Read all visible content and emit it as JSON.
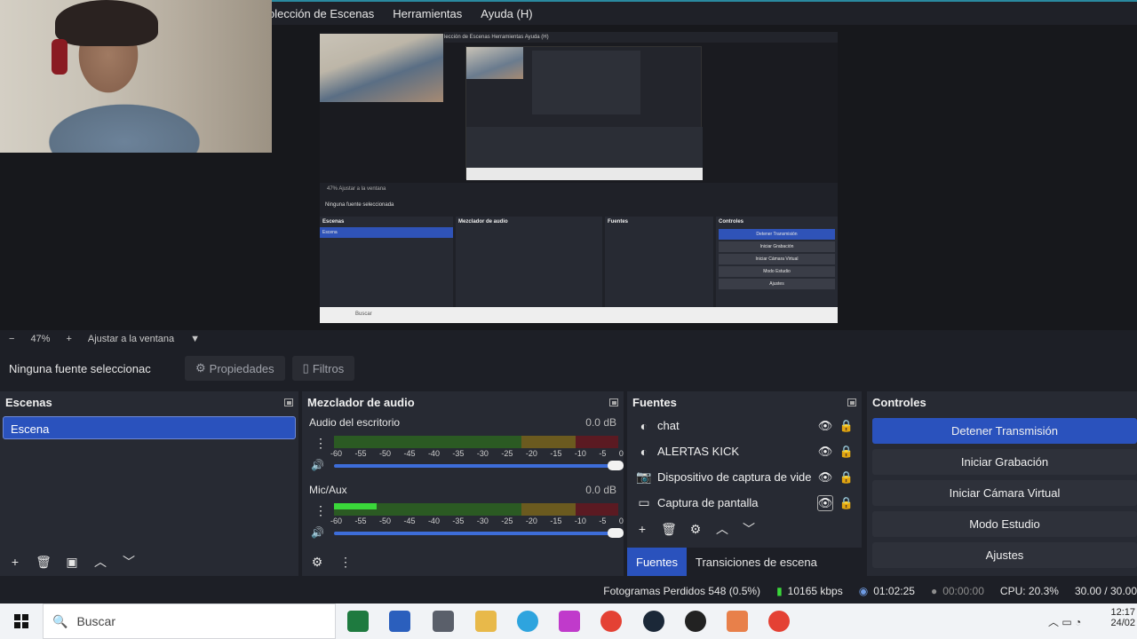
{
  "menu": {
    "items": [
      "olección de Escenas",
      "Herramientas",
      "Ayuda (H)"
    ]
  },
  "preview": {
    "menu_text": "lección de Escenas   Herramientas   Ayuda (H)",
    "zoom_text": "47%   Ajustar a la ventana",
    "source_text": "Ninguna fuente seleccionada",
    "docks": {
      "scenes": "Escenas",
      "scene": "Escena",
      "mixer": "Mezclador de audio",
      "sources": "Fuentes",
      "controls": "Controles"
    },
    "buttons": [
      "Detener Transmisión",
      "Iniciar Grabación",
      "Iniciar Cámara Virtual",
      "Modo Estudio",
      "Ajustes"
    ],
    "taskbar_search": "Buscar"
  },
  "zoom": {
    "minus": "−",
    "percent": "47%",
    "plus": "+",
    "fit": "Ajustar a la ventana",
    "caret": "▼"
  },
  "source_bar": {
    "no_source": "Ninguna fuente seleccionac",
    "properties": "Propiedades",
    "filters": "Filtros"
  },
  "scenes": {
    "title": "Escenas",
    "items": [
      "Escena"
    ]
  },
  "mixer": {
    "title": "Mezclador de audio",
    "channels": [
      {
        "name": "Audio del escritorio",
        "db": "0.0 dB",
        "level": 0
      },
      {
        "name": "Mic/Aux",
        "db": "0.0 dB",
        "level": 0.15
      }
    ],
    "scale": [
      "-60",
      "-55",
      "-50",
      "-45",
      "-40",
      "-35",
      "-30",
      "-25",
      "-20",
      "-15",
      "-10",
      "-5",
      "0"
    ]
  },
  "sources": {
    "title": "Fuentes",
    "items": [
      {
        "name": "chat",
        "icon": "browser-icon"
      },
      {
        "name": "ALERTAS KICK",
        "icon": "browser-icon"
      },
      {
        "name": "Dispositivo de captura de vide",
        "icon": "camera-icon"
      },
      {
        "name": "Captura de pantalla",
        "icon": "monitor-icon"
      }
    ],
    "tabs": [
      "Fuentes",
      "Transiciones de escena"
    ]
  },
  "controls": {
    "title": "Controles",
    "buttons": [
      "Detener Transmisión",
      "Iniciar Grabación",
      "Iniciar Cámara Virtual",
      "Modo Estudio",
      "Ajustes"
    ]
  },
  "status": {
    "dropped": "Fotogramas Perdidos 548 (0.5%)",
    "kbps": "10165 kbps",
    "live_time": "01:02:25",
    "rec_time": "00:00:00",
    "cpu": "CPU: 20.3%",
    "fps": "30.00 / 30.00"
  },
  "taskbar": {
    "search": "Buscar",
    "time": "12:17",
    "date": "24/02"
  },
  "colors": {
    "accent": "#2a52bd",
    "background": "#1d1f26",
    "dock": "#272a33"
  }
}
